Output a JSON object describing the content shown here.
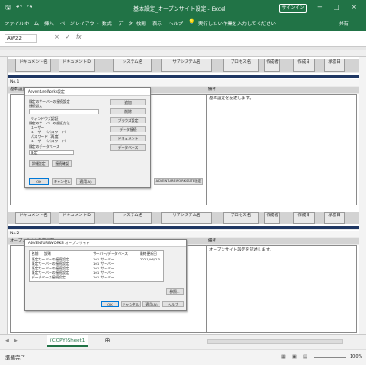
{
  "titlebar": {
    "doc_title": "基本設定_オープンサイト設定 - Excel",
    "user_label": "サインイン",
    "minimize": "−",
    "maximize": "□",
    "close": "×",
    "save": "🖫",
    "undo": "↶",
    "redo": "↷"
  },
  "ribbon": {
    "tabs": [
      "ファイル",
      "ホーム",
      "挿入",
      "ページレイアウト",
      "数式",
      "データ",
      "校閲",
      "表示",
      "ヘルプ"
    ],
    "search_placeholder": "実行したい作業を入力してください",
    "share_label": "共有"
  },
  "formula_bar": {
    "name_box": "AW22",
    "cancel": "×",
    "enter": "✓",
    "fx": "fx"
  },
  "sheet": {
    "block1": {
      "headers": [
        "ドキュメント名",
        "ドキュメントID",
        "システム名",
        "サブシステム名",
        "プロセス名",
        "作成者",
        "作成日",
        "承認日"
      ],
      "no_label": "No.1",
      "section_title": "基本設定画面",
      "note_label": "備考",
      "note_text": "基本設定を記述します。"
    },
    "block2": {
      "headers": [
        "ドキュメント名",
        "ドキュメントID",
        "システム名",
        "サブシステム名",
        "プロセス名",
        "作成者",
        "作成日",
        "承認日"
      ],
      "no_label": "No.2",
      "section_title": "オープンサイト設定画面",
      "note_label": "備考",
      "note_text": "オープンサイト設定を記述します。"
    },
    "dialog1": {
      "title": "AdventureWorks設定",
      "lines": [
        "既定のサーバーの接続設定",
        "接続設定",
        "ウィンドウズ認証",
        "既定のサーバーの認証方法",
        "ユーザー",
        "ユーザー（パスワード）",
        "パスワード（再度）",
        "ユーザー（パスワード）",
        "既定のデータベース",
        "既定"
      ],
      "side_buttons": [
        "追加",
        "削除",
        "ブラウズ設定",
        "データ接続",
        "ドキュメント",
        "データベース"
      ],
      "bottom_buttons": [
        "OK",
        "キャンセル",
        "適用(A)"
      ],
      "mid_buttons": [
        "詳細設定",
        "接続確認"
      ],
      "right_button": "ADVENTUREWORKSSITE設定"
    },
    "dialog2": {
      "title": "ADVENTUREWORKS オープンサイト",
      "col_headers": [
        "名前",
        "説明",
        "サーバー/データベース",
        "最終更新日"
      ],
      "rows": [
        [
          "既定サーバーの接続設定",
          "101 サーバー",
          "2021/06/23"
        ],
        [
          "既定サーバーの接続設定",
          "101 サーバー",
          "2021/06/23"
        ],
        [
          "既定サーバーの接続設定",
          "101 サーバー",
          "2021/06/23"
        ],
        [
          "既定サーバーの接続設定",
          "101 サーバー",
          "2021/06/23"
        ],
        [
          "データベース接続設定",
          "101 サーバー",
          "2021/06/23"
        ]
      ],
      "side_button": "参照...",
      "bottom_buttons": [
        "OK",
        "キャンセル",
        "適用(A)",
        "ヘルプ"
      ]
    }
  },
  "tabs_bar": {
    "sheet_tab": "(COPY)Sheet1",
    "add_sheet": "⊕",
    "nav_prev": "◀",
    "nav_next": "▶"
  },
  "status": {
    "ready": "準備完了",
    "zoom": "100%"
  },
  "colors": {
    "excel_green": "#217346",
    "navy": "#1f3763"
  }
}
